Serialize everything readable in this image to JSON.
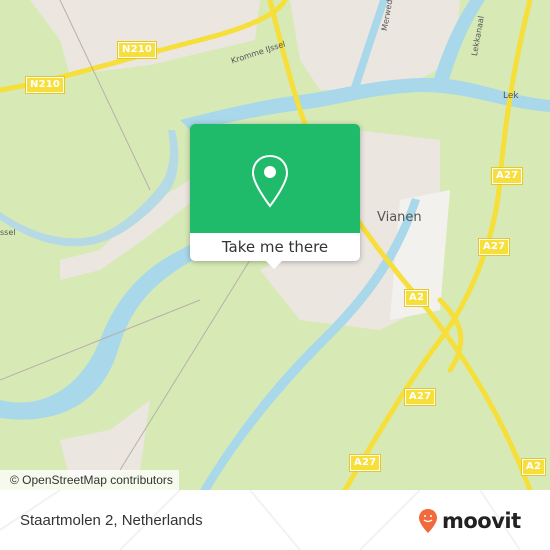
{
  "map": {
    "place_labels": {
      "vianen": "Vianen",
      "kromme_ijssel": "Kromme IJssel",
      "merwedekanaal": "Merwedekanaal",
      "lekkanaal": "Lekkanaal",
      "lek": "Lek",
      "west_edge": "ssel"
    },
    "road_shields": {
      "n210_a": "N210",
      "n210_b": "N210",
      "a27_a": "A27",
      "a27_b": "A27",
      "a27_c": "A27",
      "a27_d": "A27",
      "a2_a": "A2",
      "a2_b": "A2"
    },
    "attribution": "© OpenStreetMap contributors",
    "colors": {
      "land": "#d7eab6",
      "water": "#a8d8ea",
      "urban": "#ece6e0",
      "highway": "#f6de3b",
      "accent": "#20ba6b"
    }
  },
  "popup": {
    "icon": "map-pin-icon",
    "button_label": "Take me there"
  },
  "footer": {
    "address": "Staartmolen 2, Netherlands",
    "brand": "moovit",
    "brand_icon": "moovit-smile-pin-icon",
    "brand_color": "#f26a3c"
  }
}
